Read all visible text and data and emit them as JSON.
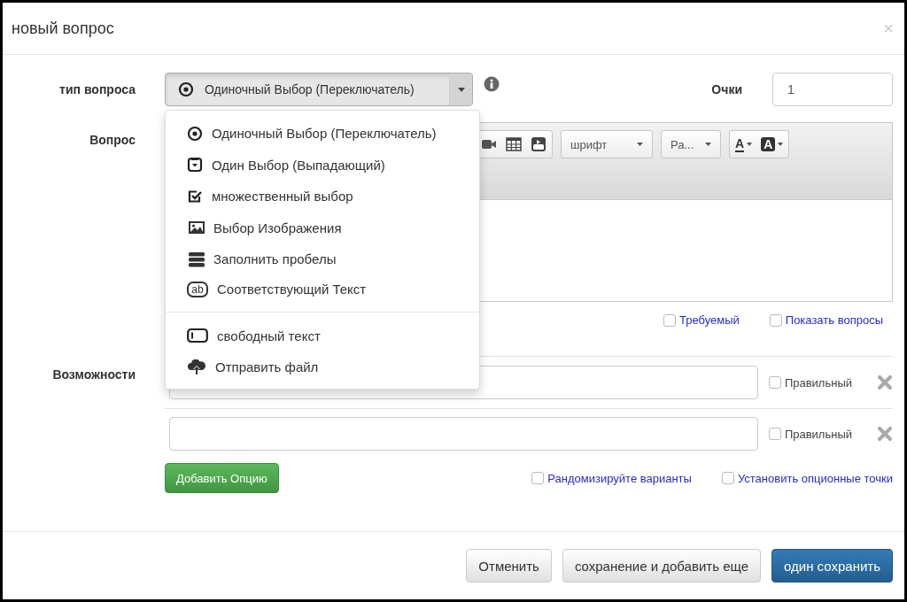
{
  "dialog": {
    "title": "новый вопрос",
    "close": "×"
  },
  "type_field": {
    "label": "тип вопроса",
    "value": "Одиночный Выбор (Переключатель)",
    "expanded": true
  },
  "points": {
    "label": "Очки",
    "value": "1"
  },
  "question": {
    "label": "Вопрос",
    "toolbar": [
      {
        "kind": "video"
      },
      {
        "kind": "table"
      },
      {
        "kind": "youtube"
      },
      {
        "kind": "select",
        "label": "шрифт"
      },
      {
        "kind": "select",
        "label": "Ра..."
      },
      {
        "kind": "color",
        "label": "A"
      },
      {
        "kind": "highlight",
        "label": "A"
      }
    ]
  },
  "type_menu": {
    "groups": [
      [
        {
          "kind": "radio",
          "label": "Одиночный Выбор (Переключатель)"
        },
        {
          "kind": "dropdown",
          "label": "Один Выбор (Выпадающий)"
        },
        {
          "kind": "multiple",
          "label": "множественный выбор"
        },
        {
          "kind": "image",
          "label": "Выбор Изображения"
        },
        {
          "kind": "blanks",
          "label": "Заполнить пробелы"
        },
        {
          "kind": "matching",
          "label": "Соответствующий Текст",
          "badge": "ab"
        }
      ],
      [
        {
          "kind": "freetext",
          "label": "свободный текст"
        },
        {
          "kind": "upload",
          "label": "Отправить файл"
        }
      ]
    ]
  },
  "question_options": [
    {
      "label": "Требуемый",
      "checked": false
    },
    {
      "label": "Показать вопросы",
      "checked": false
    }
  ],
  "choices": {
    "label": "Возможности",
    "rows": [
      {
        "correct_label": "Правильный",
        "checked": false
      },
      {
        "correct_label": "Правильный",
        "checked": false
      }
    ],
    "add_button": "Добавить Опцию",
    "settings": [
      {
        "label": "Рандомизируйте варианты",
        "checked": false
      },
      {
        "label": "Установить опционные точки",
        "checked": false
      }
    ]
  },
  "footer": [
    {
      "label": "Отменить",
      "kind": "default"
    },
    {
      "label": "сохранение и добавить еще",
      "kind": "default"
    },
    {
      "label": "один сохранить",
      "kind": "primary"
    }
  ]
}
